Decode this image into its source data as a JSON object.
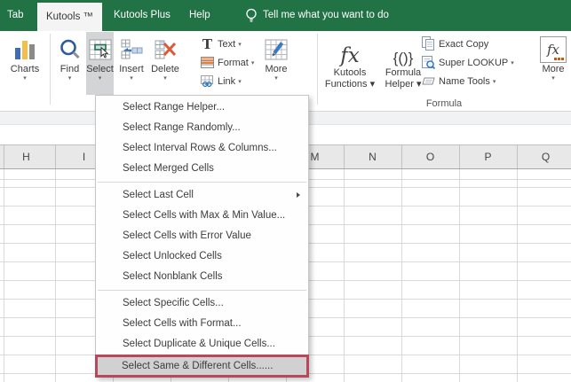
{
  "colors": {
    "excel_green": "#217346",
    "highlight_red": "#b8495c",
    "pressed_gray": "#d2d4d6"
  },
  "icons": {
    "dropdown": "▾",
    "text_glyph": "T",
    "fx_glyph": "fx",
    "formula_helper_glyph": "{()}"
  },
  "tabbar": {
    "partial_tab": "Tab",
    "active_tab": "Kutools ™",
    "kutools_plus": "Kutools Plus",
    "help": "Help",
    "tell_me": "Tell me what you want to do"
  },
  "ribbon": {
    "charts": "Charts",
    "find": "Find",
    "select": "Select",
    "insert": "Insert",
    "delete": "Delete",
    "stack1": [
      {
        "label": "Text"
      },
      {
        "label": "Format"
      },
      {
        "label": "Link"
      }
    ],
    "more_small": "More",
    "kutools_functions": {
      "line1": "Kutools",
      "line2": "Functions"
    },
    "formula_helper": {
      "line1": "Formula",
      "line2": "Helper"
    },
    "stack2": [
      {
        "label": "Exact Copy"
      },
      {
        "label": "Super LOOKUP"
      },
      {
        "label": "Name Tools"
      }
    ],
    "more_fx": "More",
    "group_label": "Formula"
  },
  "menu": {
    "items": [
      {
        "label": "Select Range Helper..."
      },
      {
        "label": "Select Range Randomly..."
      },
      {
        "label": "Select Interval Rows & Columns..."
      },
      {
        "label": "Select Merged Cells"
      },
      {
        "label": "Select Last Cell"
      },
      {
        "label": "Select Cells with Max & Min Value..."
      },
      {
        "label": "Select Cells with Error Value"
      },
      {
        "label": "Select Unlocked Cells"
      },
      {
        "label": "Select Nonblank Cells"
      },
      {
        "label": "Select Specific Cells..."
      },
      {
        "label": "Select Cells with Format..."
      },
      {
        "label": "Select Duplicate & Unique Cells..."
      },
      {
        "label": "Select Same & Different Cells......"
      }
    ]
  },
  "sheet": {
    "columns": [
      "H",
      "I",
      "M",
      "N",
      "O",
      "P",
      "Q"
    ]
  }
}
